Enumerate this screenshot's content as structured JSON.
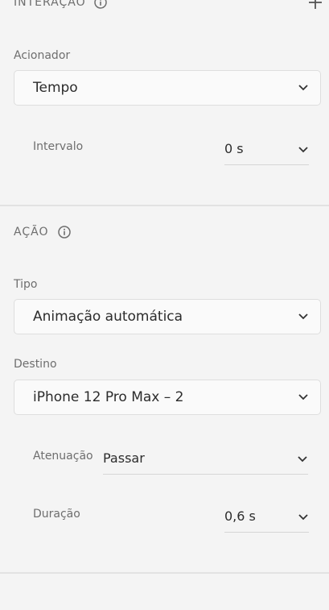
{
  "interaction": {
    "header": "INTERAÇÃO",
    "trigger_label": "Acionador",
    "trigger_value": "Tempo",
    "interval_label": "Intervalo",
    "interval_value": "0 s"
  },
  "action": {
    "header": "AÇÃO",
    "type_label": "Tipo",
    "type_value": "Animação automática",
    "destination_label": "Destino",
    "destination_value": "iPhone 12 Pro Max – 2",
    "easing_label": "Atenuação",
    "easing_value": "Passar",
    "duration_label": "Duração",
    "duration_value": "0,6 s"
  },
  "icons": {
    "info": "info-icon",
    "add": "plus-icon",
    "dropdown": "chevron-down-icon"
  },
  "colors": {
    "panel_bg": "#f4f4f4",
    "field_bg": "#fafafa",
    "label": "#6e6e6e",
    "text": "#2c2c2c"
  }
}
